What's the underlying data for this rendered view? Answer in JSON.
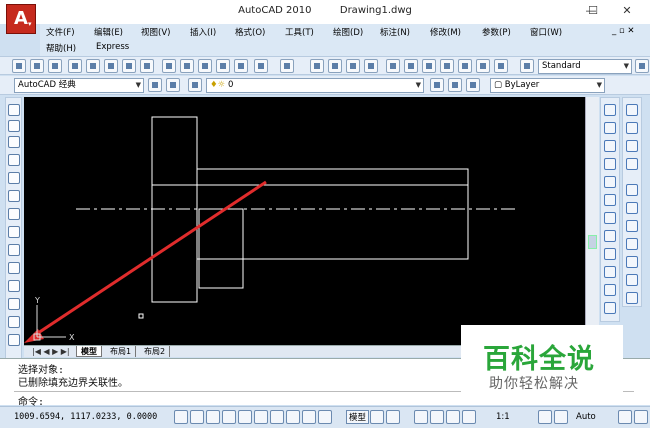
{
  "app": {
    "title": "AutoCAD 2010",
    "document": "Drawing1.dwg",
    "logo_letter": "A"
  },
  "window_controls": {
    "minimize": "—",
    "maximize": "☐",
    "close": "✕"
  },
  "menu": {
    "items": [
      "文件(F)",
      "编辑(E)",
      "视图(V)",
      "插入(I)",
      "格式(O)",
      "工具(T)",
      "绘图(D)",
      "标注(N)",
      "修改(M)",
      "参数(P)",
      "窗口(W)"
    ],
    "row2": [
      "帮助(H)",
      "Express"
    ]
  },
  "toolbar": {
    "text_style": "Standard",
    "workspace": "AutoCAD 经典",
    "layer": "0",
    "color": "ByLayer"
  },
  "layout_tabs": [
    "模型",
    "布局1",
    "布局2"
  ],
  "command": {
    "history": [
      "选择对象:",
      "已删除填充边界关联性。"
    ],
    "prompt": "命令:"
  },
  "status": {
    "coordinates": "1009.6594,  1117.0233,  0.0000",
    "model_label": "模型",
    "scale": "1:1",
    "auto_label": "Auto"
  },
  "ucs": {
    "y": "Y",
    "x": "X"
  },
  "watermark": {
    "title": "百科全说",
    "subtitle": "助你轻松解决"
  }
}
